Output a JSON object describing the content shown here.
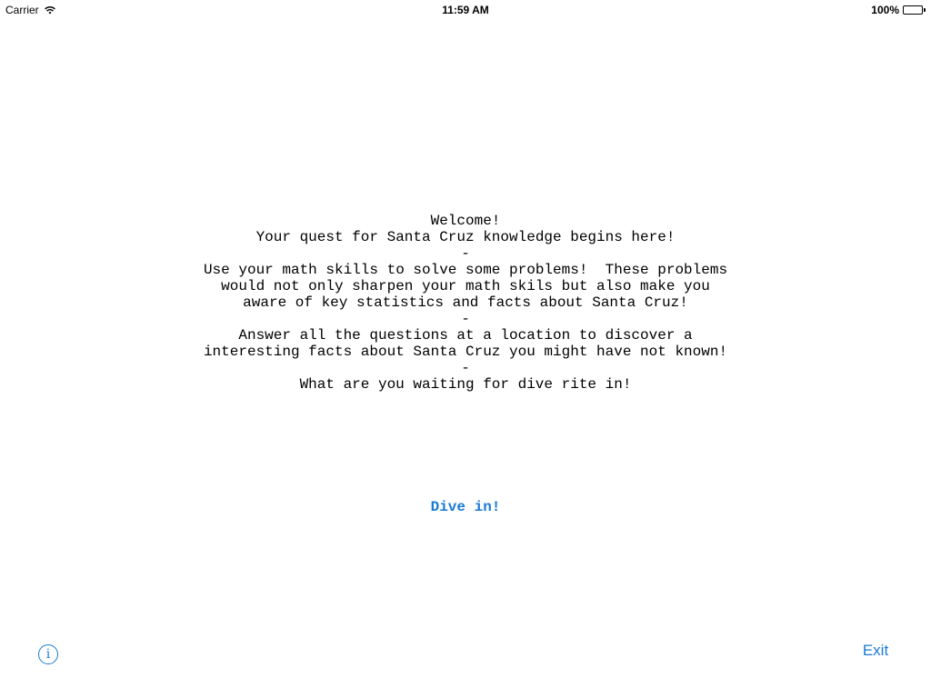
{
  "status_bar": {
    "carrier": "Carrier",
    "time": "11:59 AM",
    "battery_percent": "100%",
    "icons": [
      "wifi-icon",
      "battery-icon"
    ]
  },
  "welcome": {
    "lines": [
      "Welcome!",
      "Your quest for Santa Cruz knowledge begins here!",
      "-",
      "Use your math skills to solve some problems!  These problems",
      "would not only sharpen your math skils but also make you",
      "aware of key statistics and facts about Santa Cruz!",
      "-",
      "Answer all the questions at a location to discover a",
      "interesting facts about Santa Cruz you might have not known!",
      "-",
      "What are you waiting for dive rite in!"
    ]
  },
  "buttons": {
    "dive_in": "Dive in!",
    "info_glyph": "i",
    "exit": "Exit"
  },
  "colors": {
    "accent": "#1a7ad6",
    "text": "#000000",
    "background": "#ffffff"
  }
}
